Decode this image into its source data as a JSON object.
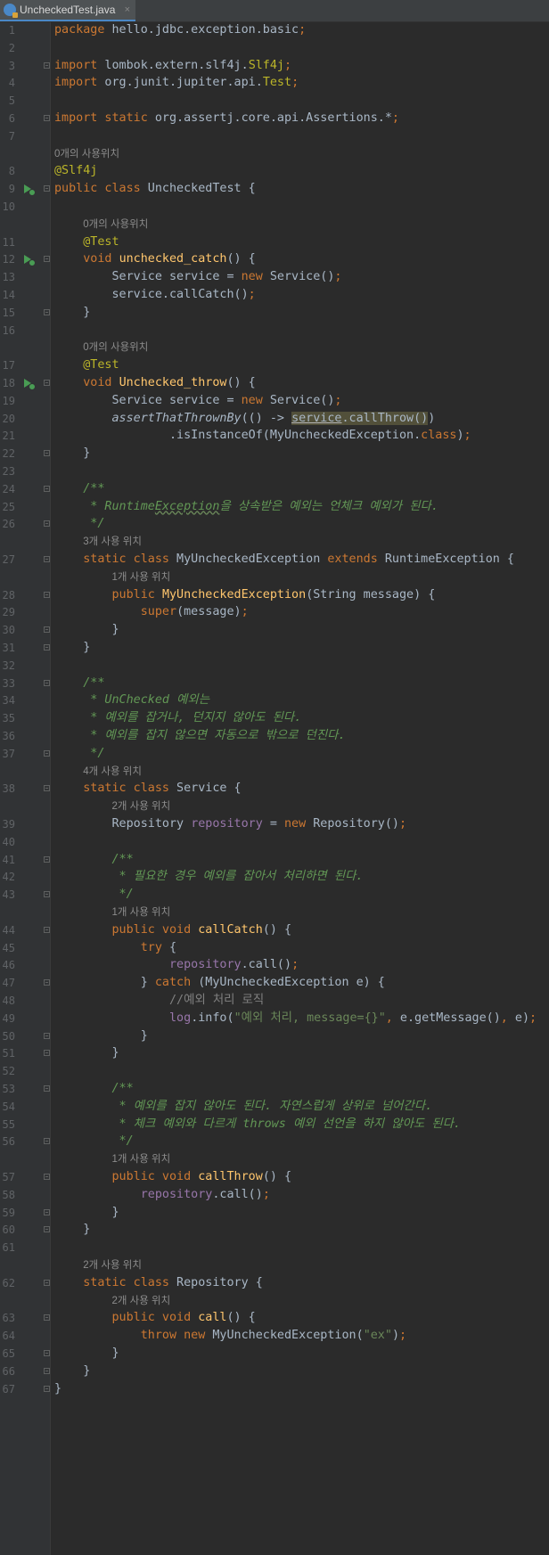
{
  "tab": {
    "title": "UncheckedTest.java",
    "close": "×"
  },
  "hints": {
    "h0": "0개의 사용위치",
    "h3": "3개 사용 위치",
    "h1": "1개 사용 위치",
    "h4": "4개 사용 위치",
    "h2": "2개 사용 위치"
  },
  "lines": [
    {
      "n": "1",
      "t": [
        [
          "package",
          "kw"
        ],
        [
          " hello.jdbc.exception.basic",
          ""
        ],
        [
          ";",
          "kw"
        ]
      ]
    },
    {
      "n": "2",
      "t": []
    },
    {
      "n": "3",
      "t": [
        [
          "import",
          "kw"
        ],
        [
          " lombok.extern.slf4j.",
          ""
        ],
        [
          "Slf4j",
          "ann"
        ],
        [
          ";",
          "kw"
        ]
      ]
    },
    {
      "n": "4",
      "t": [
        [
          "import",
          "kw"
        ],
        [
          " org.junit.jupiter.api.",
          ""
        ],
        [
          "Test",
          "ann"
        ],
        [
          ";",
          "kw"
        ]
      ]
    },
    {
      "n": "5",
      "t": []
    },
    {
      "n": "6",
      "t": [
        [
          "import static",
          "kw"
        ],
        [
          " org.assertj.core.api.Assertions.*",
          ""
        ],
        [
          ";",
          "kw"
        ]
      ]
    },
    {
      "n": "7",
      "t": []
    },
    {
      "hint": "0개의 사용위치",
      "ind": 0
    },
    {
      "n": "8",
      "t": [
        [
          "@Slf4j",
          "ann"
        ]
      ]
    },
    {
      "n": "9",
      "t": [
        [
          "public class",
          "kw"
        ],
        [
          " UncheckedTest {",
          ""
        ]
      ]
    },
    {
      "n": "10",
      "t": []
    },
    {
      "hint": "0개의 사용위치",
      "ind": 1
    },
    {
      "n": "11",
      "t": [
        [
          "    ",
          ""
        ],
        [
          "@Test",
          "ann"
        ]
      ]
    },
    {
      "n": "12",
      "t": [
        [
          "    ",
          ""
        ],
        [
          "void",
          "kw"
        ],
        [
          " ",
          ""
        ],
        [
          "unchecked_catch",
          "fn"
        ],
        [
          "() {",
          ""
        ]
      ]
    },
    {
      "n": "13",
      "t": [
        [
          "        Service service = ",
          ""
        ],
        [
          "new",
          "kw"
        ],
        [
          " Service()",
          ""
        ],
        [
          ";",
          "kw"
        ]
      ]
    },
    {
      "n": "14",
      "t": [
        [
          "        service.callCatch()",
          ""
        ],
        [
          ";",
          "kw"
        ]
      ]
    },
    {
      "n": "15",
      "t": [
        [
          "    }",
          ""
        ]
      ]
    },
    {
      "n": "16",
      "t": []
    },
    {
      "hint": "0개의 사용위치",
      "ind": 1
    },
    {
      "n": "17",
      "t": [
        [
          "    ",
          ""
        ],
        [
          "@Test",
          "ann"
        ]
      ]
    },
    {
      "n": "18",
      "t": [
        [
          "    ",
          ""
        ],
        [
          "void",
          "kw"
        ],
        [
          " ",
          ""
        ],
        [
          "Unchecked_throw",
          "fn"
        ],
        [
          "() {",
          ""
        ]
      ]
    },
    {
      "n": "19",
      "t": [
        [
          "        Service service = ",
          ""
        ],
        [
          "new",
          "kw"
        ],
        [
          " Service()",
          ""
        ],
        [
          ";",
          "kw"
        ]
      ]
    },
    {
      "n": "20",
      "t": [
        [
          "        ",
          ""
        ],
        [
          "assertThatThrownBy",
          "it"
        ],
        [
          "(() -> ",
          ""
        ],
        [
          "service",
          "hl usl"
        ],
        [
          ".callThrow()",
          "hl"
        ],
        [
          ")",
          ""
        ]
      ]
    },
    {
      "n": "21",
      "t": [
        [
          "                .isInstanceOf(MyUncheckedException.",
          ""
        ],
        [
          "class",
          "kw"
        ],
        [
          ")",
          ""
        ],
        [
          ";",
          "kw"
        ]
      ]
    },
    {
      "n": "22",
      "t": [
        [
          "    }",
          ""
        ]
      ]
    },
    {
      "n": "23",
      "t": []
    },
    {
      "n": "24",
      "t": [
        [
          "    /**",
          "doc"
        ]
      ]
    },
    {
      "n": "25",
      "t": [
        [
          "     * Runtime",
          "doc"
        ],
        [
          "Exception",
          "doc sq"
        ],
        [
          "을 상속받은 예외는 언체크 예외가 된다.",
          "doc"
        ]
      ]
    },
    {
      "n": "26",
      "t": [
        [
          "     */",
          "doc"
        ]
      ]
    },
    {
      "hint": "3개 사용 위치",
      "ind": 1
    },
    {
      "n": "27",
      "t": [
        [
          "    ",
          ""
        ],
        [
          "static class",
          "kw"
        ],
        [
          " MyUncheckedException ",
          ""
        ],
        [
          "extends",
          "kw"
        ],
        [
          " RuntimeException {",
          ""
        ]
      ]
    },
    {
      "hint": "1개 사용 위치",
      "ind": 2
    },
    {
      "n": "28",
      "t": [
        [
          "        ",
          ""
        ],
        [
          "public",
          "kw"
        ],
        [
          " ",
          ""
        ],
        [
          "MyUncheckedException",
          "fn"
        ],
        [
          "(String message) {",
          ""
        ]
      ]
    },
    {
      "n": "29",
      "t": [
        [
          "            ",
          ""
        ],
        [
          "super",
          "kw"
        ],
        [
          "(message)",
          ""
        ],
        [
          ";",
          "kw"
        ]
      ]
    },
    {
      "n": "30",
      "t": [
        [
          "        }",
          ""
        ]
      ]
    },
    {
      "n": "31",
      "t": [
        [
          "    }",
          ""
        ]
      ]
    },
    {
      "n": "32",
      "t": []
    },
    {
      "n": "33",
      "t": [
        [
          "    /**",
          "doc"
        ]
      ]
    },
    {
      "n": "34",
      "t": [
        [
          "     * UnChecked 예외는",
          "doc"
        ]
      ]
    },
    {
      "n": "35",
      "t": [
        [
          "     * 예외를 잡거나, 던지지 않아도 된다.",
          "doc"
        ]
      ]
    },
    {
      "n": "36",
      "t": [
        [
          "     * 예외를 잡지 않으면 자동으로 밖으로 던진다.",
          "doc"
        ]
      ]
    },
    {
      "n": "37",
      "t": [
        [
          "     */",
          "doc"
        ]
      ]
    },
    {
      "hint": "4개 사용 위치",
      "ind": 1
    },
    {
      "n": "38",
      "t": [
        [
          "    ",
          ""
        ],
        [
          "static class",
          "kw"
        ],
        [
          " Service {",
          ""
        ]
      ]
    },
    {
      "hint": "2개 사용 위치",
      "ind": 2
    },
    {
      "n": "39",
      "t": [
        [
          "        Repository ",
          ""
        ],
        [
          "repository",
          "fld"
        ],
        [
          " = ",
          ""
        ],
        [
          "new",
          "kw"
        ],
        [
          " Repository()",
          ""
        ],
        [
          ";",
          "kw"
        ]
      ]
    },
    {
      "n": "40",
      "t": []
    },
    {
      "n": "41",
      "t": [
        [
          "        /**",
          "doc"
        ]
      ]
    },
    {
      "n": "42",
      "t": [
        [
          "         * 필요한 경우 예외를 잡아서 처리하면 된다.",
          "doc"
        ]
      ]
    },
    {
      "n": "43",
      "t": [
        [
          "         */",
          "doc"
        ]
      ]
    },
    {
      "hint": "1개 사용 위치",
      "ind": 2
    },
    {
      "n": "44",
      "t": [
        [
          "        ",
          ""
        ],
        [
          "public void",
          "kw"
        ],
        [
          " ",
          ""
        ],
        [
          "callCatch",
          "fn"
        ],
        [
          "() {",
          ""
        ]
      ]
    },
    {
      "n": "45",
      "t": [
        [
          "            ",
          ""
        ],
        [
          "try",
          "kw"
        ],
        [
          " {",
          ""
        ]
      ]
    },
    {
      "n": "46",
      "t": [
        [
          "                ",
          ""
        ],
        [
          "repository",
          "fld"
        ],
        [
          ".call()",
          ""
        ],
        [
          ";",
          "kw"
        ]
      ]
    },
    {
      "n": "47",
      "t": [
        [
          "            } ",
          ""
        ],
        [
          "catch",
          "kw"
        ],
        [
          " (MyUncheckedException e) {",
          ""
        ]
      ]
    },
    {
      "n": "48",
      "t": [
        [
          "                ",
          ""
        ],
        [
          "//예외 처리 로직",
          "lc"
        ]
      ]
    },
    {
      "n": "49",
      "t": [
        [
          "                ",
          ""
        ],
        [
          "log",
          "fld"
        ],
        [
          ".info(",
          ""
        ],
        [
          "\"예외 처리, message={}\"",
          "str"
        ],
        [
          ", ",
          "kw"
        ],
        [
          "e.getMessage()",
          ""
        ],
        [
          ", ",
          "kw"
        ],
        [
          "e)",
          ""
        ],
        [
          ";",
          "kw"
        ]
      ]
    },
    {
      "n": "50",
      "t": [
        [
          "            }",
          ""
        ]
      ]
    },
    {
      "n": "51",
      "t": [
        [
          "        }",
          ""
        ]
      ]
    },
    {
      "n": "52",
      "t": []
    },
    {
      "n": "53",
      "t": [
        [
          "        /**",
          "doc"
        ]
      ]
    },
    {
      "n": "54",
      "t": [
        [
          "         * 예외를 잡지 않아도 된다. 자연스럽게 상위로 넘어간다.",
          "doc"
        ]
      ]
    },
    {
      "n": "55",
      "t": [
        [
          "         * 체크 예외와 다르게 throws 예외 선언을 하지 않아도 된다.",
          "doc"
        ]
      ]
    },
    {
      "n": "56",
      "t": [
        [
          "         */",
          "doc"
        ]
      ]
    },
    {
      "hint": "1개 사용 위치",
      "ind": 2
    },
    {
      "n": "57",
      "t": [
        [
          "        ",
          ""
        ],
        [
          "public void",
          "kw"
        ],
        [
          " ",
          ""
        ],
        [
          "callThrow",
          "fn"
        ],
        [
          "() {",
          ""
        ]
      ]
    },
    {
      "n": "58",
      "t": [
        [
          "            ",
          ""
        ],
        [
          "repository",
          "fld"
        ],
        [
          ".call()",
          ""
        ],
        [
          ";",
          "kw"
        ]
      ]
    },
    {
      "n": "59",
      "t": [
        [
          "        }",
          ""
        ]
      ]
    },
    {
      "n": "60",
      "t": [
        [
          "    }",
          ""
        ]
      ]
    },
    {
      "n": "61",
      "t": []
    },
    {
      "hint": "2개 사용 위치",
      "ind": 1
    },
    {
      "n": "62",
      "t": [
        [
          "    ",
          ""
        ],
        [
          "static class",
          "kw"
        ],
        [
          " Repository {",
          ""
        ]
      ]
    },
    {
      "hint": "2개 사용 위치",
      "ind": 2
    },
    {
      "n": "63",
      "t": [
        [
          "        ",
          ""
        ],
        [
          "public void",
          "kw"
        ],
        [
          " ",
          ""
        ],
        [
          "call",
          "fn"
        ],
        [
          "() {",
          ""
        ]
      ]
    },
    {
      "n": "64",
      "t": [
        [
          "            ",
          ""
        ],
        [
          "throw new",
          "kw"
        ],
        [
          " MyUncheckedException(",
          ""
        ],
        [
          "\"ex\"",
          "str"
        ],
        [
          ")",
          ""
        ],
        [
          ";",
          "kw"
        ]
      ]
    },
    {
      "n": "65",
      "t": [
        [
          "        }",
          ""
        ]
      ]
    },
    {
      "n": "66",
      "t": [
        [
          "    }",
          ""
        ]
      ]
    },
    {
      "n": "67",
      "t": [
        [
          "}",
          ""
        ]
      ]
    }
  ]
}
